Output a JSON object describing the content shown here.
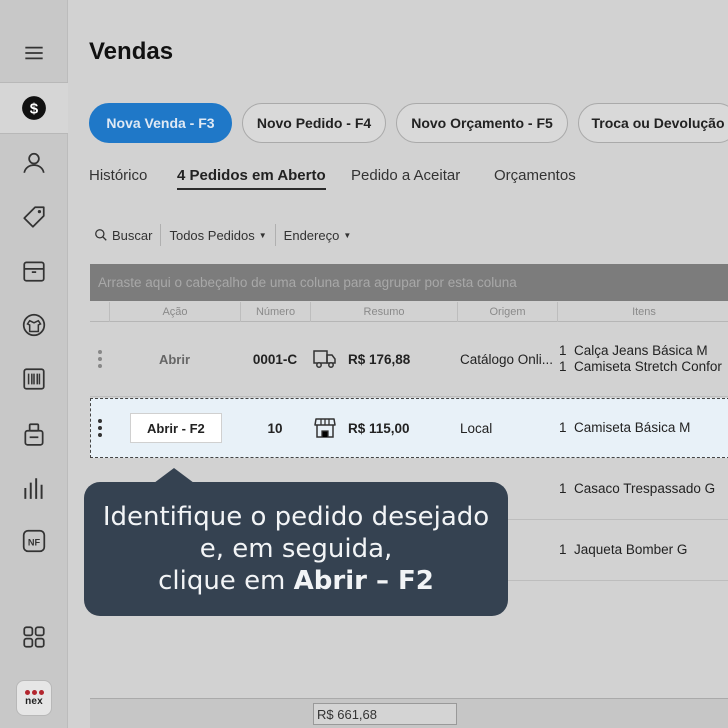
{
  "page": {
    "title": "Vendas"
  },
  "sidebar": {
    "items": [
      {
        "icon": "hamburger-menu-icon"
      },
      {
        "icon": "dollar-icon",
        "active": true
      },
      {
        "icon": "user-icon"
      },
      {
        "icon": "tag-icon"
      },
      {
        "icon": "box-icon"
      },
      {
        "icon": "tshirt-icon"
      },
      {
        "icon": "barcode-icon"
      },
      {
        "icon": "clipboard-icon"
      },
      {
        "icon": "bar-chart-icon"
      },
      {
        "icon": "nf-invoice-icon",
        "label": "NF"
      },
      {
        "icon": "apps-grid-icon"
      }
    ],
    "logo": {
      "text": "nex",
      "accent": "#b3262e"
    }
  },
  "actions": {
    "new_sale": "Nova Venda - F3",
    "new_order": "Novo Pedido - F4",
    "new_quote": "Novo Orçamento - F5",
    "exchange": "Troca ou Devolução"
  },
  "tabs": {
    "history": "Histórico",
    "open_orders": "4 Pedidos em Aberto",
    "to_accept": "Pedido a Aceitar",
    "quotes": "Orçamentos"
  },
  "toolbar": {
    "search": "Buscar",
    "orders_filter": "Todos Pedidos",
    "address_filter": "Endereço"
  },
  "grid": {
    "group_hint": "Arraste aqui o cabeçalho de uma coluna para agrupar por esta coluna",
    "columns": {
      "action": "Ação",
      "number": "Número",
      "summary": "Resumo",
      "origin": "Origem",
      "items": "Itens"
    },
    "rows": [
      {
        "action": "Abrir",
        "number": "0001-C",
        "summary_icon": "delivery-truck-icon",
        "summary": "R$ 176,88",
        "origin": "Catálogo Onli...",
        "items": [
          {
            "qty": "1",
            "name": "Calça Jeans Básica M"
          },
          {
            "qty": "1",
            "name": "Camiseta Stretch Confor"
          }
        ]
      },
      {
        "action": "Abrir - F2",
        "number": "10",
        "summary_icon": "storefront-icon",
        "summary": "R$ 115,00",
        "origin": "Local",
        "items": [
          {
            "qty": "1",
            "name": "Camiseta Básica M"
          }
        ],
        "selected": true
      },
      {
        "items": [
          {
            "qty": "1",
            "name": "Casaco Trespassado G"
          }
        ]
      },
      {
        "items": [
          {
            "qty": "1",
            "name": "Jaqueta Bomber G"
          }
        ]
      }
    ],
    "footer_total": "R$ 661,68"
  },
  "tooltip": {
    "line1": "Identifique o pedido desejado",
    "line2": "e, em seguida,",
    "line3_prefix": "clique em",
    "line3_bold": "Abrir – F2"
  },
  "colors": {
    "primary": "#1f78c8",
    "tooltip_bg": "#354251",
    "selected_row": "#e8f1f8"
  }
}
